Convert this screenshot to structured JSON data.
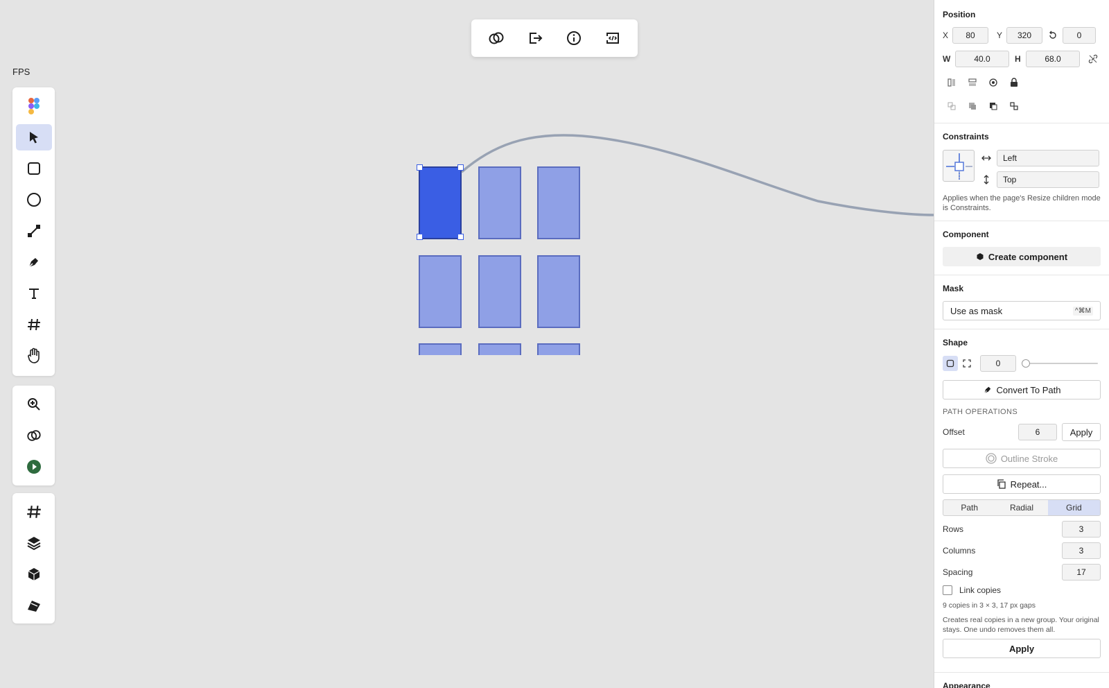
{
  "canvas": {
    "fps_label": "FPS"
  },
  "top_toolbar": {
    "items": [
      "boolean-icon",
      "export-icon",
      "info-icon",
      "code-icon"
    ]
  },
  "tools": {
    "group1": [
      "figma-logo-icon",
      "pointer-icon",
      "rectangle-icon",
      "ellipse-icon",
      "line-icon",
      "pen-icon",
      "text-icon",
      "frame-icon",
      "hand-icon"
    ],
    "group2": [
      "zoom-in-icon",
      "boolean-icon",
      "play-icon"
    ],
    "group3": [
      "frame-icon",
      "layers-icon",
      "component-icon",
      "assets-icon"
    ],
    "active": "pointer-icon"
  },
  "panel": {
    "position": {
      "title": "Position",
      "x_label": "X",
      "x": "80",
      "y_label": "Y",
      "y": "320",
      "rotation": "0",
      "w_label": "W",
      "w": "40.0",
      "h_label": "H",
      "h": "68.0"
    },
    "constraints": {
      "title": "Constraints",
      "horizontal": "Left",
      "vertical": "Top",
      "note": "Applies when the page's Resize children mode is Constraints."
    },
    "component": {
      "title": "Component",
      "create_label": "Create component"
    },
    "mask": {
      "title": "Mask",
      "use_label": "Use as mask",
      "shortcut": "^⌘M"
    },
    "shape": {
      "title": "Shape",
      "radius": "0",
      "slider_value": 0,
      "convert_label": "Convert To Path",
      "path_ops_label": "PATH OPERATIONS",
      "offset_label": "Offset",
      "offset_value": "6",
      "apply_label": "Apply",
      "outline_label": "Outline Stroke",
      "repeat_label": "Repeat...",
      "modes": [
        "Path",
        "Radial",
        "Grid"
      ],
      "active_mode": "Grid",
      "rows_label": "Rows",
      "rows": "3",
      "columns_label": "Columns",
      "columns": "3",
      "spacing_label": "Spacing",
      "spacing": "17",
      "link_label": "Link copies",
      "link_checked": false,
      "summary": "9 copies in 3 × 3, 17 px gaps",
      "note": "Creates real copies in a new group. Your original stays. One undo removes them all.",
      "apply2_label": "Apply"
    },
    "appearance": {
      "title": "Appearance"
    }
  },
  "colors": {
    "accent": "#3a5ee4",
    "copy_fill": "#8fa0e6",
    "copy_stroke": "#5a6cbf",
    "canvas_bg": "#e4e4e4",
    "selected_tab": "#d7def5"
  }
}
